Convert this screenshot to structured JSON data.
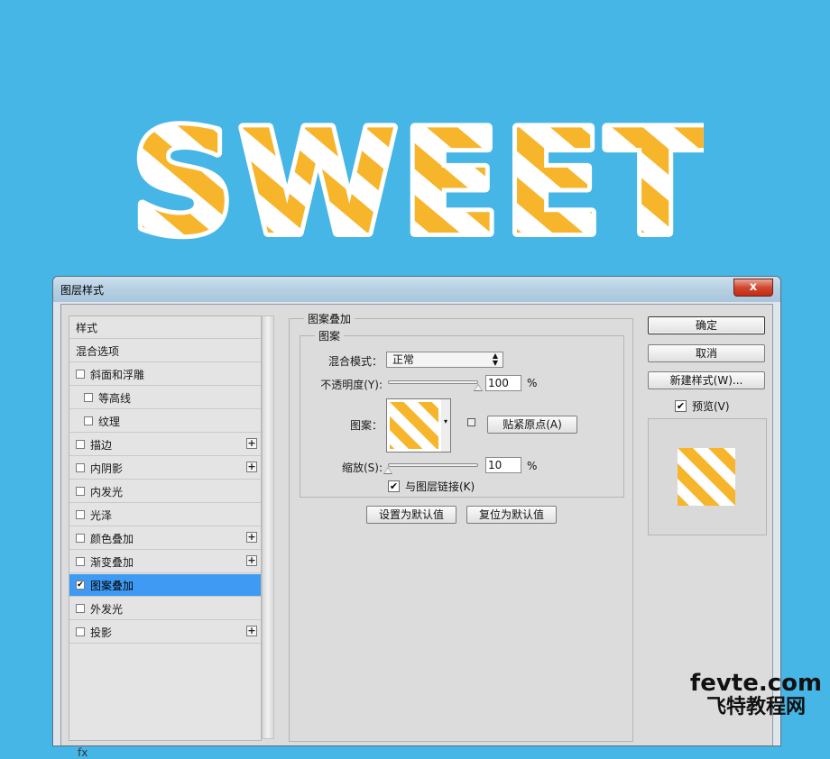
{
  "artwork": {
    "text": "SWEET",
    "stripe_color_a": "#f7b52c",
    "stripe_color_b": "#ffffff",
    "background": "#45b6e6"
  },
  "window": {
    "title": "图层样式",
    "close_glyph": "x"
  },
  "style_list": {
    "items": [
      {
        "label": "样式",
        "kind": "heading",
        "checked": false,
        "has_plus": false
      },
      {
        "label": "混合选项",
        "kind": "heading",
        "checked": false,
        "has_plus": false
      },
      {
        "label": "斜面和浮雕",
        "kind": "option",
        "checked": false,
        "has_plus": false
      },
      {
        "label": "等高线",
        "kind": "sub",
        "checked": false,
        "has_plus": false
      },
      {
        "label": "纹理",
        "kind": "sub",
        "checked": false,
        "has_plus": false
      },
      {
        "label": "描边",
        "kind": "option",
        "checked": false,
        "has_plus": true
      },
      {
        "label": "内阴影",
        "kind": "option",
        "checked": false,
        "has_plus": true
      },
      {
        "label": "内发光",
        "kind": "option",
        "checked": false,
        "has_plus": false
      },
      {
        "label": "光泽",
        "kind": "option",
        "checked": false,
        "has_plus": false
      },
      {
        "label": "颜色叠加",
        "kind": "option",
        "checked": false,
        "has_plus": true
      },
      {
        "label": "渐变叠加",
        "kind": "option",
        "checked": false,
        "has_plus": true
      },
      {
        "label": "图案叠加",
        "kind": "option",
        "checked": true,
        "has_plus": false,
        "selected": true
      },
      {
        "label": "外发光",
        "kind": "option",
        "checked": false,
        "has_plus": false
      },
      {
        "label": "投影",
        "kind": "option",
        "checked": false,
        "has_plus": true
      }
    ],
    "bottom_icons": "fx"
  },
  "panel": {
    "section_title": "图案叠加",
    "group_title": "图案",
    "blend_mode_label": "混合模式：",
    "blend_mode_value": "正常",
    "opacity_label": "不透明度(Y):",
    "opacity_value": "100",
    "opacity_level": 1.0,
    "opacity_unit": "%",
    "pattern_label": "图案：",
    "snap_button": "贴紧原点(A)",
    "scale_label": "缩放(S):",
    "scale_value": "10",
    "scale_level": 0.0,
    "scale_unit": "%",
    "link_label": "与图层链接(K)",
    "link_checked": true,
    "set_default_button": "设置为默认值",
    "reset_default_button": "复位为默认值"
  },
  "side_buttons": {
    "ok": "确定",
    "cancel": "取消",
    "new_style": "新建样式(W)...",
    "preview_label": "预览(V)",
    "preview_checked": true
  },
  "watermark": {
    "top": "fevte.com",
    "bottom": "飞特教程网"
  },
  "glyphs": {
    "check": "✔",
    "plus": "+",
    "dropdown": "▾",
    "updown": "⇕"
  }
}
